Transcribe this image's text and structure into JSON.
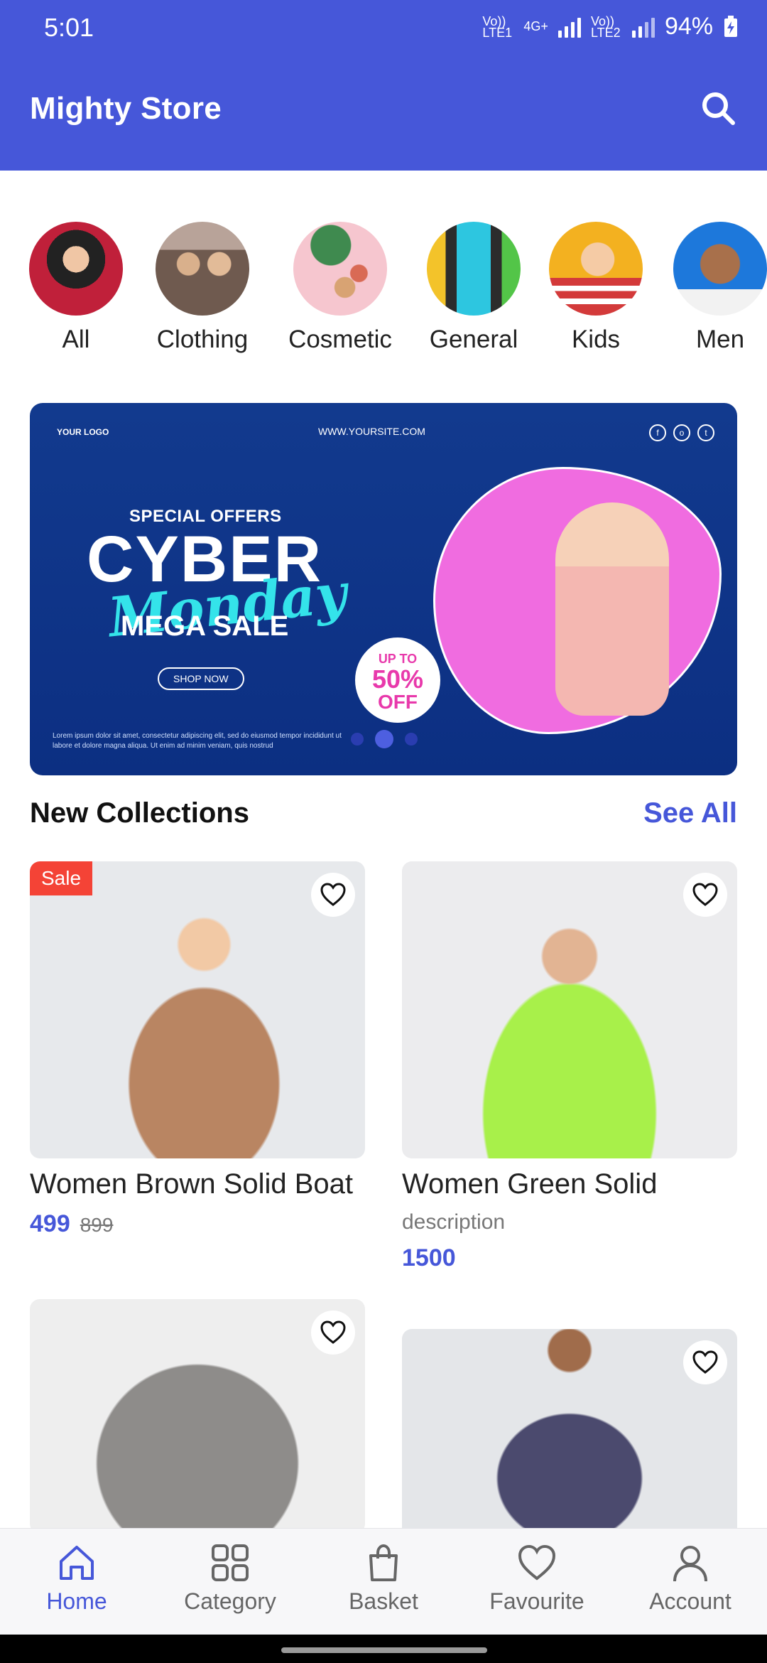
{
  "status_bar": {
    "time": "5:01",
    "net1": "Vo)) LTE1",
    "net_type": "4G+",
    "net2": "Vo)) LTE2",
    "battery": "94%"
  },
  "app_bar": {
    "title": "Mighty Store",
    "search_icon": "search-icon"
  },
  "categories": [
    {
      "label": "All",
      "color": "#d02a3e"
    },
    {
      "label": "Clothing",
      "color": "#a88f84"
    },
    {
      "label": "Cosmetic",
      "color": "#f5c3cb"
    },
    {
      "label": "General",
      "color": "#333333"
    },
    {
      "label": "Kids",
      "color": "#f2b21e"
    },
    {
      "label": "Men",
      "color": "#1e73d8"
    }
  ],
  "banner": {
    "logo": "YOUR LOGO",
    "site": "WWW.YOURSITE.COM",
    "special": "SPECIAL OFFERS",
    "cyber": "CYBER",
    "monday": "Monday",
    "mega": "MEGA SALE",
    "shop": "SHOP NOW",
    "badge_top": "UP TO",
    "badge_mid": "50%",
    "badge_bot": "OFF",
    "lorem": "Lorem ipsum dolor sit amet, consectetur adipiscing elit, sed do eiusmod tempor incididunt ut labore et dolore magna aliqua. Ut enim ad minim veniam, quis nostrud",
    "slide_index": 1,
    "slide_count": 3
  },
  "new_collections": {
    "title": "New Collections",
    "see_all": "See All",
    "products": [
      {
        "name": "Women Brown Solid Boat",
        "price": "499",
        "old_price": "899",
        "sale": "Sale"
      },
      {
        "name": "Women Green Solid",
        "desc": "description",
        "price": "1500"
      }
    ]
  },
  "bottom_nav": {
    "items": [
      {
        "label": "Home",
        "icon": "home-icon",
        "active": true
      },
      {
        "label": "Category",
        "icon": "grid-icon"
      },
      {
        "label": "Basket",
        "icon": "bag-icon"
      },
      {
        "label": "Favourite",
        "icon": "heart-icon"
      },
      {
        "label": "Account",
        "icon": "person-icon"
      }
    ]
  },
  "colors": {
    "primary": "#4657d9",
    "sale": "#f44336"
  }
}
